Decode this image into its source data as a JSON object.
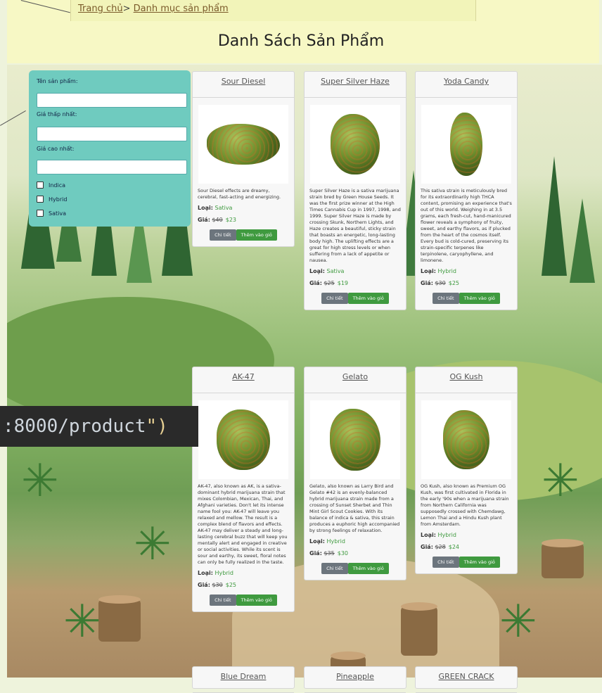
{
  "breadcrumb": {
    "home": "Trang chủ",
    "separator": ">",
    "current": "Danh mục sản phẩm"
  },
  "page_title": "Danh Sách Sản Phẩm",
  "filter": {
    "name_label": "Tên sản phẩm:",
    "min_price_label": "Giá thấp nhất:",
    "max_price_label": "Giá cao nhất:",
    "name_value": "",
    "min_value": "",
    "max_value": "",
    "checkboxes": [
      "Indica",
      "Hybrid",
      "Sativa"
    ]
  },
  "labels": {
    "type": "Loại:",
    "price": "Giá:",
    "detail_button": "Chi tiết",
    "cart_button": "Thêm vào giỏ"
  },
  "products": [
    {
      "name": "Sour Diesel",
      "desc": "Sour Diesel effects are dreamy, cerebral, fast-acting and energizing.",
      "type": "Sativa",
      "old_price": "$40",
      "new_price": "$23"
    },
    {
      "name": "Super Silver Haze",
      "desc": "Super Silver Haze is a sativa marijuana strain bred by Green House Seeds. It was the first prize winner at the High Times Cannabis Cup in 1997, 1998, and 1999. Super Silver Haze is made by crossing Skunk, Northern Lights, and Haze creates a beautiful, sticky strain that boasts an energetic, long-lasting body high. The uplifting effects are a great for high stress levels or when suffering from a lack of appetite or nausea.",
      "type": "Sativa",
      "old_price": "$25",
      "new_price": "$19"
    },
    {
      "name": "Yoda Candy",
      "desc": "This sativa strain is meticulously bred for its extraordinarily high THCA content, promising an experience that's out of this world. Weighing in at 3.5 grams, each fresh-cut, hand-manicured flower reveals a symphony of fruity, sweet, and earthy flavors, as if plucked from the heart of the cosmos itself. Every bud is cold-cured, preserving its strain-specific terpenes like terpinolene, caryophyllene, and limonene.",
      "type": "Hybrid",
      "old_price": "$30",
      "new_price": "$25"
    },
    {
      "name": "AK-47",
      "desc": "AK-47, also known as AK, is a sativa-dominant hybrid marijuana strain that mixes Colombian, Mexican, Thai, and Afghani varieties. Don't let its intense name fool you: AK-47 will leave you relaxed and mellow. The result is a complex blend of flavors and effects. AK-47 may deliver a steady and long-lasting cerebral buzz that will keep you mentally alert and engaged in creative or social activities. While its scent is sour and earthy, its sweet, floral notes can only be fully realized in the taste.",
      "type": "Hybrid",
      "old_price": "$30",
      "new_price": "$25"
    },
    {
      "name": "Gelato",
      "desc": "Gelato, also known as Larry Bird and Gelato #42 is an evenly-balanced hybrid marijuana strain made from a crossing of Sunset Sherbet and Thin Mint Girl Scout Cookies. With its balance of indica & sativa, this strain produces a euphoric high accompanied by strong feelings of relaxation.",
      "type": "Hybrid",
      "old_price": "$35",
      "new_price": "$30"
    },
    {
      "name": "OG Kush",
      "desc": "OG Kush, also known as Premium OG Kush, was first cultivated in Florida in the early '90s when a marijuana strain from Northern California was supposedly crossed with Chemdawg, Lemon Thai and a Hindu Kush plant from Amsterdam.",
      "type": "Hybrid",
      "old_price": "$28",
      "new_price": "$24"
    }
  ],
  "next_row_titles": [
    "Blue Dream",
    "Pineapple",
    "GREEN CRACK"
  ],
  "code_overlay": {
    "prefix": ":8000/product",
    "suffix": "\")"
  }
}
